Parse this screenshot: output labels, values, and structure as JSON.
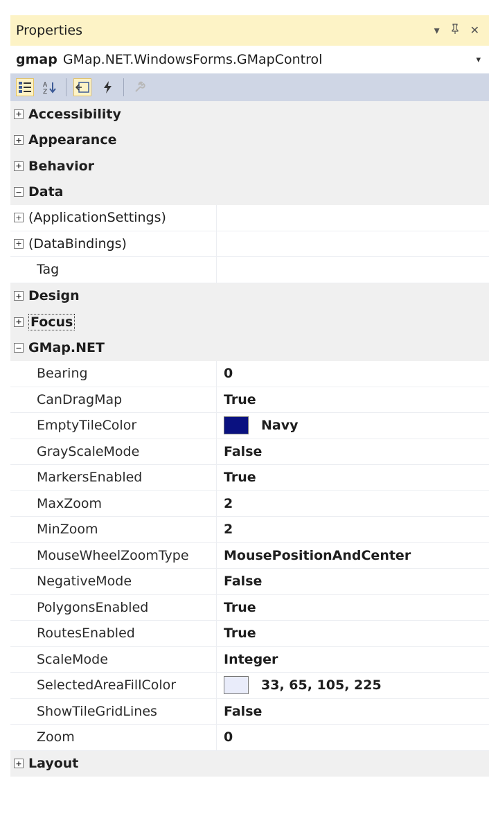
{
  "window": {
    "title": "Properties",
    "menu_icon": "dropdown-arrow-icon",
    "pin_icon": "pin-icon",
    "close_icon": "close-icon"
  },
  "object_selector": {
    "name": "gmap",
    "type": "GMap.NET.WindowsForms.GMapControl"
  },
  "toolbar": {
    "buttons": [
      "categorized-icon",
      "alphabetical-icon",
      "properties-icon",
      "events-icon",
      "property-pages-icon"
    ]
  },
  "categories": {
    "accessibility": "Accessibility",
    "appearance": "Appearance",
    "behavior": "Behavior",
    "data": "Data",
    "design": "Design",
    "focus": "Focus",
    "gmap": "GMap.NET",
    "layout": "Layout"
  },
  "data_props": {
    "app_settings": "(ApplicationSettings)",
    "data_bindings": "(DataBindings)",
    "tag": "Tag"
  },
  "gmap_props": [
    {
      "name": "Bearing",
      "value": "0"
    },
    {
      "name": "CanDragMap",
      "value": "True"
    },
    {
      "name": "EmptyTileColor",
      "value": "Navy"
    },
    {
      "name": "GrayScaleMode",
      "value": "False"
    },
    {
      "name": "MarkersEnabled",
      "value": "True"
    },
    {
      "name": "MaxZoom",
      "value": "2"
    },
    {
      "name": "MinZoom",
      "value": "2"
    },
    {
      "name": "MouseWheelZoomType",
      "value": "MousePositionAndCenter"
    },
    {
      "name": "NegativeMode",
      "value": "False"
    },
    {
      "name": "PolygonsEnabled",
      "value": "True"
    },
    {
      "name": "RoutesEnabled",
      "value": "True"
    },
    {
      "name": "ScaleMode",
      "value": "Integer"
    },
    {
      "name": "SelectedAreaFillColor",
      "value": "33, 65, 105, 225"
    },
    {
      "name": "ShowTileGridLines",
      "value": "False"
    },
    {
      "name": "Zoom",
      "value": "0"
    }
  ],
  "colors": {
    "navy": "#0a1180",
    "selected_area": "#e9ecfa",
    "title_bg": "#fdf3c6",
    "toolbar_bg": "#cfd6e5"
  }
}
